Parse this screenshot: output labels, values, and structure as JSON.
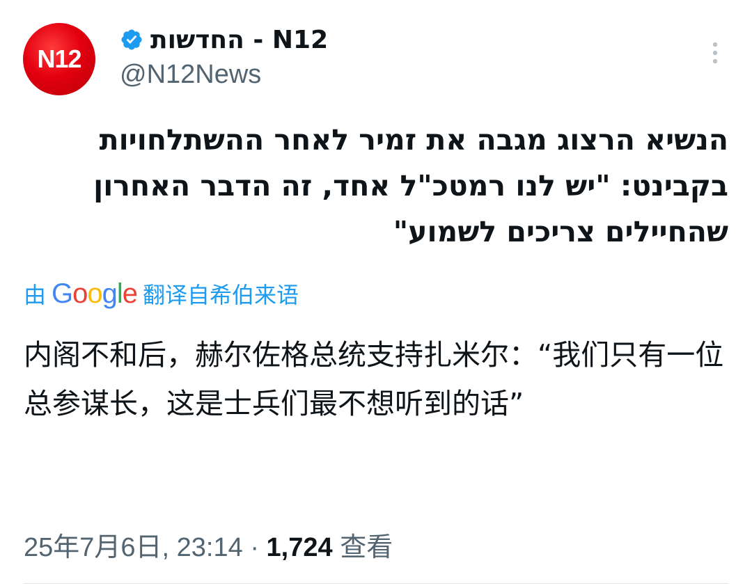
{
  "author": {
    "avatar_text": "N12",
    "display_name": "החדשות - N12",
    "handle": "@N12News",
    "verified": true,
    "verified_color": "#1d9bf0",
    "avatar_color": "#e3000f"
  },
  "tweet": {
    "text": "הנשיא הרצוג מגבה את זמיר לאחר ההשתלחויות בקבינט: \"יש לנו רמטכ\"ל אחד, זה הדבר האחרון שהחיילים צריכים לשמוע\"",
    "translation_prefix": "由",
    "translation_provider": "Google",
    "translation_suffix": "翻译自希伯来语",
    "translated_text": "内阁不和后，赫尔佐格总统支持扎米尔：“我们只有一位总参谋长，这是士兵们最不想听到的话”",
    "date": "25年7月6日, 23:14",
    "separator": "·",
    "views": "1,724",
    "views_label": "查看"
  },
  "icons": {
    "more": "more-vertical-icon",
    "verified": "verified-badge-icon"
  },
  "colors": {
    "link": "#1d9bf0",
    "secondary_text": "#536471",
    "primary_text": "#0f1419"
  }
}
